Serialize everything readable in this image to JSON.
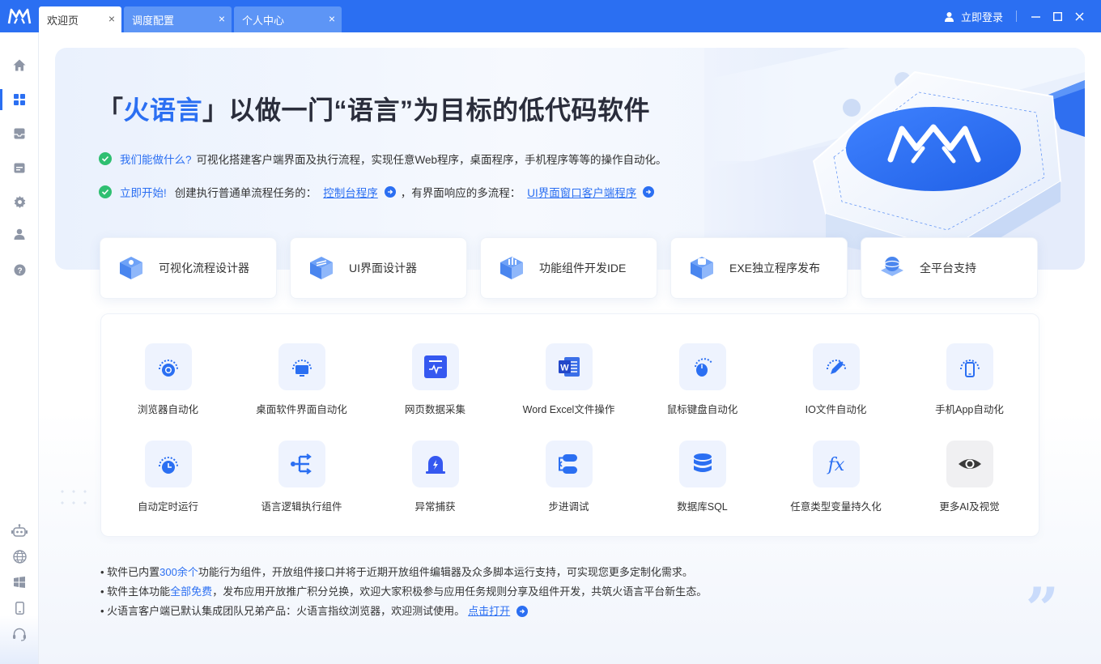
{
  "titlebar": {
    "tabs": [
      {
        "label": "欢迎页",
        "active": true
      },
      {
        "label": "调度配置",
        "active": false
      },
      {
        "label": "个人中心",
        "active": false
      }
    ],
    "login_label": "立即登录",
    "close_glyph": "×"
  },
  "sidebar": {
    "items": [
      "home-icon",
      "apps-icon",
      "inbox-icon",
      "calendar-icon",
      "gear-icon",
      "user-icon",
      "help-icon"
    ],
    "bottom_items": [
      "robot-icon",
      "globe-icon",
      "windows-icon",
      "mobile-icon",
      "headset-icon"
    ]
  },
  "hero": {
    "title_open": "「",
    "title_brand": "火语言",
    "title_rest": "」以做一门“语言”为目标的低代码软件",
    "line1": {
      "lead": "我们能做什么?",
      "text": "可视化搭建客户端界面及执行流程，实现任意Web程序，桌面程序，手机程序等等的操作自动化。"
    },
    "line2": {
      "lead": "立即开始!",
      "text1": "创建执行普通单流程任务的：",
      "link1": "控制台程序",
      "text2": "，有界面响应的多流程：",
      "link2": "UI界面窗口客户端程序"
    }
  },
  "features": [
    {
      "label": "可视化流程设计器",
      "icon": "flow-designer-icon"
    },
    {
      "label": "UI界面设计器",
      "icon": "ui-designer-icon"
    },
    {
      "label": "功能组件开发IDE",
      "icon": "ide-icon"
    },
    {
      "label": "EXE独立程序发布",
      "icon": "exe-publish-icon"
    },
    {
      "label": "全平台支持",
      "icon": "cross-platform-icon"
    }
  ],
  "grid": [
    {
      "label": "浏览器自动化",
      "icon": "browser-icon"
    },
    {
      "label": "桌面软件界面自动化",
      "icon": "desktop-icon"
    },
    {
      "label": "网页数据采集",
      "icon": "web-scrape-icon"
    },
    {
      "label": "Word Excel文件操作",
      "icon": "word-icon"
    },
    {
      "label": "鼠标键盘自动化",
      "icon": "mouse-icon"
    },
    {
      "label": "IO文件自动化",
      "icon": "io-file-icon"
    },
    {
      "label": "手机App自动化",
      "icon": "phone-icon"
    },
    {
      "label": "自动定时运行",
      "icon": "clock-icon"
    },
    {
      "label": "语言逻辑执行组件",
      "icon": "logic-icon"
    },
    {
      "label": "异常捕获",
      "icon": "alarm-icon"
    },
    {
      "label": "步进调试",
      "icon": "debug-icon"
    },
    {
      "label": "数据库SQL",
      "icon": "database-icon"
    },
    {
      "label": "任意类型变量持久化",
      "icon": "fx-icon"
    },
    {
      "label": "更多AI及视觉",
      "icon": "eye-icon"
    }
  ],
  "notes": {
    "n1_a": "• 软件已内置",
    "n1_b": "300余个",
    "n1_c": "功能行为组件，开放组件接口并将于近期开放组件编辑器及众多脚本运行支持，可实现您更多定制化需求。",
    "n2_a": "• 软件主体功能",
    "n2_b": "全部免费",
    "n2_c": "，发布应用开放推广积分兑换，欢迎大家积极参与应用任务规则分享及组件开发，共筑火语言平台新生态。",
    "n3_a": "• 火语言客户端已默认集成团队兄弟产品：火语言指纹浏览器，欢迎测试使用。",
    "n3_link": "点击打开"
  },
  "quote_glyph": "”",
  "colors": {
    "accent": "#2b6ff2",
    "check": "#2fbf71"
  }
}
